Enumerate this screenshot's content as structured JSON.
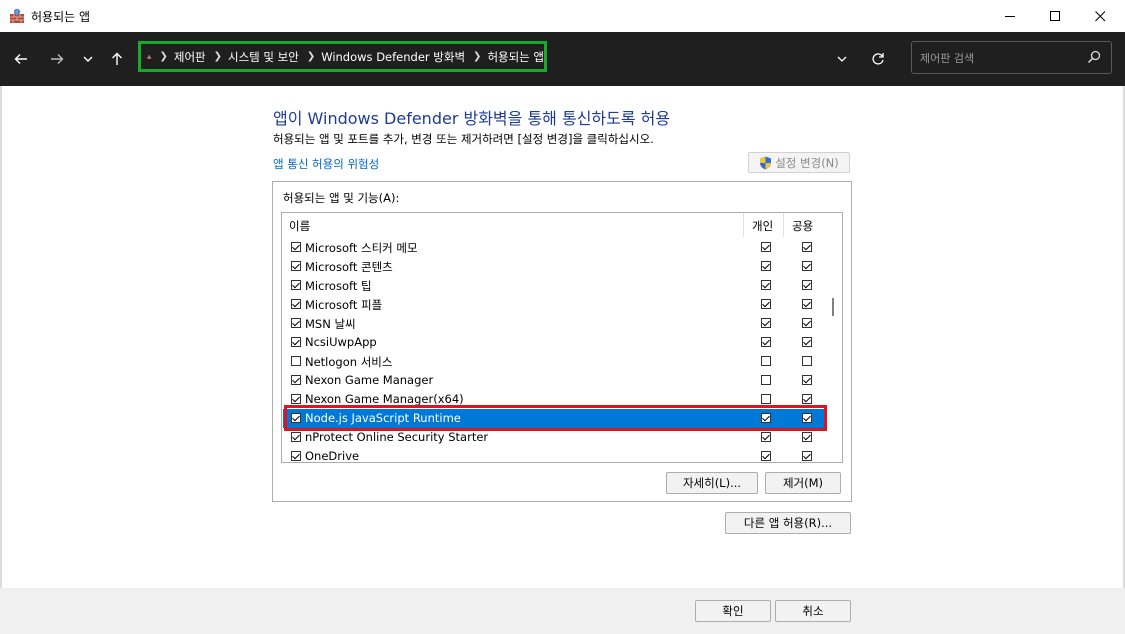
{
  "window": {
    "title": "허용되는 앱"
  },
  "nav": {
    "breadcrumbs": [
      "제어판",
      "시스템 및 보안",
      "Windows Defender 방화벽",
      "허용되는 앱"
    ],
    "search_placeholder": "제어판 검색"
  },
  "main": {
    "heading": "앱이 Windows Defender 방화벽을 통해 통신하도록 허용",
    "description": "허용되는 앱 및 포트를 추가, 변경 또는 제거하려면 [설정 변경]을 클릭하십시오.",
    "risk_link": "앱 통신 허용의 위험성",
    "change_settings_label": "설정 변경(N)",
    "group_label": "허용되는 앱 및 기능(A):",
    "columns": {
      "name": "이름",
      "private": "개인",
      "public": "공용"
    },
    "rows": [
      {
        "name": "Microsoft 스티커 메모",
        "enabled": true,
        "private": true,
        "public": true
      },
      {
        "name": "Microsoft 콘텐츠",
        "enabled": true,
        "private": true,
        "public": true
      },
      {
        "name": "Microsoft 팁",
        "enabled": true,
        "private": true,
        "public": true
      },
      {
        "name": "Microsoft 피플",
        "enabled": true,
        "private": true,
        "public": true
      },
      {
        "name": "MSN 날씨",
        "enabled": true,
        "private": true,
        "public": true
      },
      {
        "name": "NcsiUwpApp",
        "enabled": true,
        "private": true,
        "public": true
      },
      {
        "name": "Netlogon 서비스",
        "enabled": false,
        "private": false,
        "public": false
      },
      {
        "name": "Nexon Game Manager",
        "enabled": true,
        "private": false,
        "public": true
      },
      {
        "name": "Nexon Game Manager(x64)",
        "enabled": true,
        "private": false,
        "public": true
      },
      {
        "name": "Node.js JavaScript Runtime",
        "enabled": true,
        "private": true,
        "public": true,
        "selected": true
      },
      {
        "name": "nProtect Online Security Starter",
        "enabled": true,
        "private": true,
        "public": true
      },
      {
        "name": "OneDrive",
        "enabled": true,
        "private": true,
        "public": true
      }
    ],
    "details_button": "자세히(L)...",
    "remove_button": "제거(M)",
    "allow_other_button": "다른 앱 허용(R)..."
  },
  "footer": {
    "ok_button": "확인",
    "cancel_button": "취소"
  },
  "colors": {
    "selection": "#0078d7",
    "heading": "#1e3c96",
    "link": "#0066cc",
    "highlight_green": "#18a82a",
    "highlight_red": "#d8171f"
  }
}
